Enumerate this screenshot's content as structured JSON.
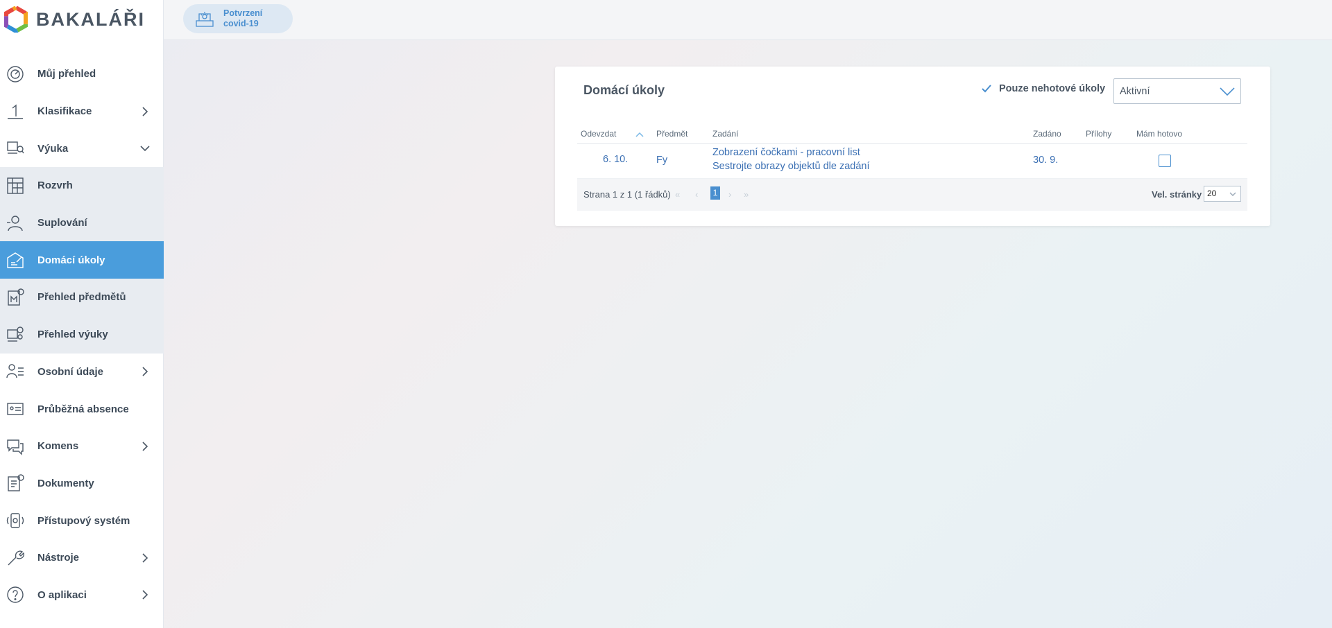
{
  "app": {
    "logo_text": "BAKALÁŘI",
    "brand_colors": [
      "#e8483f",
      "#f4a21e",
      "#6fbf44",
      "#2e8fd6",
      "#8b4fb6"
    ],
    "accent": "#4a9ddc"
  },
  "topbar": {
    "covid_label_1": "Potvrzení",
    "covid_label_2": "covid-19"
  },
  "sidebar": {
    "items": [
      {
        "label": "Můj přehled",
        "icon": "dashboard-icon"
      },
      {
        "label": "Klasifikace",
        "icon": "grade-icon"
      },
      {
        "label": "Výuka",
        "icon": "teaching-icon"
      },
      {
        "label": "Rozvrh",
        "icon": "schedule-icon"
      },
      {
        "label": "Suplování",
        "icon": "substitution-icon"
      },
      {
        "label": "Domácí úkoly",
        "icon": "homework-icon"
      },
      {
        "label": "Přehled předmětů",
        "icon": "subjects-icon"
      },
      {
        "label": "Přehled výuky",
        "icon": "lessons-overview-icon"
      },
      {
        "label": "Osobní údaje",
        "icon": "personal-data-icon"
      },
      {
        "label": "Průběžná absence",
        "icon": "absence-icon"
      },
      {
        "label": "Komens",
        "icon": "messages-icon"
      },
      {
        "label": "Dokumenty",
        "icon": "documents-icon"
      },
      {
        "label": "Přístupový systém",
        "icon": "access-system-icon"
      },
      {
        "label": "Nástroje",
        "icon": "tools-icon"
      },
      {
        "label": "O aplikaci",
        "icon": "help-icon"
      }
    ]
  },
  "homework": {
    "title": "Domácí úkoly",
    "filter_label": "Pouze nehotové úkoly",
    "status_select": "Aktivní",
    "columns": {
      "due": "Odevzdat",
      "subject": "Předmět",
      "assignment": "Zadání",
      "assigned": "Zadáno",
      "attachments": "Přílohy",
      "done": "Mám hotovo"
    },
    "rows": [
      {
        "due": "6. 10.",
        "subject": "Fy",
        "assignment_line1": "Zobrazení čočkami - pracovní list",
        "assignment_line2": "Sestrojte obrazy objektů dle zadání",
        "assigned": "30. 9."
      }
    ],
    "pager": {
      "info": "Strana 1 z 1 (1 řádků)",
      "first": "«",
      "prev": "‹",
      "current_page": "1",
      "next": "›",
      "last": "»",
      "page_size_label": "Vel. stránky",
      "page_size": "20"
    }
  }
}
